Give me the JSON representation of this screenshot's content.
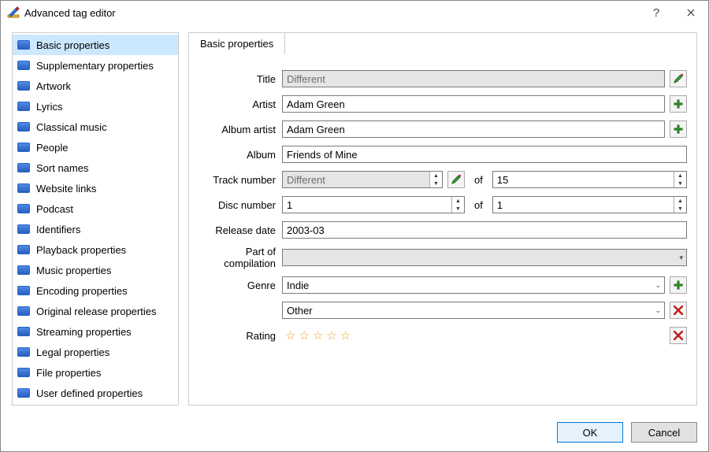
{
  "window": {
    "title": "Advanced tag editor"
  },
  "sidebar": {
    "items": [
      {
        "label": "Basic properties",
        "selected": true
      },
      {
        "label": "Supplementary properties"
      },
      {
        "label": "Artwork"
      },
      {
        "label": "Lyrics"
      },
      {
        "label": "Classical music"
      },
      {
        "label": "People"
      },
      {
        "label": "Sort names"
      },
      {
        "label": "Website links"
      },
      {
        "label": "Podcast"
      },
      {
        "label": "Identifiers"
      },
      {
        "label": "Playback properties"
      },
      {
        "label": "Music properties"
      },
      {
        "label": "Encoding properties"
      },
      {
        "label": "Original release properties"
      },
      {
        "label": "Streaming properties"
      },
      {
        "label": "Legal properties"
      },
      {
        "label": "File properties"
      },
      {
        "label": "User defined properties"
      }
    ]
  },
  "tab": {
    "label": "Basic properties"
  },
  "form": {
    "title": {
      "label": "Title",
      "value": "Different"
    },
    "artist": {
      "label": "Artist",
      "value": "Adam Green"
    },
    "album_artist": {
      "label": "Album artist",
      "value": "Adam Green"
    },
    "album": {
      "label": "Album",
      "value": "Friends of Mine"
    },
    "track_number": {
      "label": "Track number",
      "value": "Different",
      "of_label": "of",
      "total": "15"
    },
    "disc_number": {
      "label": "Disc number",
      "value": "1",
      "of_label": "of",
      "total": "1"
    },
    "release_date": {
      "label": "Release date",
      "value": "2003-03"
    },
    "compilation": {
      "label": "Part of compilation",
      "value": ""
    },
    "genre": {
      "label": "Genre",
      "value1": "Indie",
      "value2": "Other"
    },
    "rating": {
      "label": "Rating",
      "value": 0
    }
  },
  "footer": {
    "ok": "OK",
    "cancel": "Cancel"
  }
}
